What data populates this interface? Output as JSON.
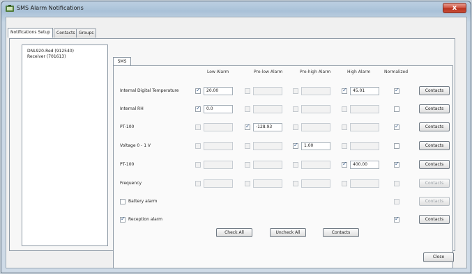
{
  "window": {
    "title": "SMS Alarm Notifications",
    "close_label": "x"
  },
  "tabs": [
    "Notifications Setup",
    "Contacts",
    "Groups"
  ],
  "tree": [
    "DNL920-Red (912540)",
    "Receiver (701613)"
  ],
  "sms_tab": "SMS",
  "columns": [
    "Low Alarm",
    "Pre-low Alarm",
    "Pre-high Alarm",
    "High Alarm",
    "Normalized"
  ],
  "rows": [
    {
      "label": "Internal Digital Temperature",
      "low": "20.00",
      "prelow": "",
      "prehigh": "",
      "high": "45.01",
      "contacts": "Contacts"
    },
    {
      "label": "Internal RH",
      "low": "0.0",
      "prelow": "",
      "prehigh": "",
      "high": "",
      "contacts": "Contacts"
    },
    {
      "label": "PT-100",
      "low": "",
      "prelow": "-128.93",
      "prehigh": "",
      "high": "",
      "contacts": "Contacts"
    },
    {
      "label": "Voltage 0 - 1 V",
      "low": "",
      "prelow": "",
      "prehigh": "1.00",
      "high": "",
      "contacts": "Contacts"
    },
    {
      "label": "PT-100",
      "low": "",
      "prelow": "",
      "prehigh": "",
      "high": "400.00",
      "contacts": "Contacts"
    },
    {
      "label": "Frequency",
      "low": "",
      "prelow": "",
      "prehigh": "",
      "high": "",
      "contacts": "Contacts"
    }
  ],
  "battery_alarm": {
    "label": "Battery alarm",
    "contacts": "Contacts"
  },
  "reception_alarm": {
    "label": "Reception alarm",
    "contacts": "Contacts"
  },
  "actions": {
    "check_all": "Check All",
    "uncheck_all": "Uncheck All",
    "contacts": "Contacts"
  },
  "close_button": "Close"
}
